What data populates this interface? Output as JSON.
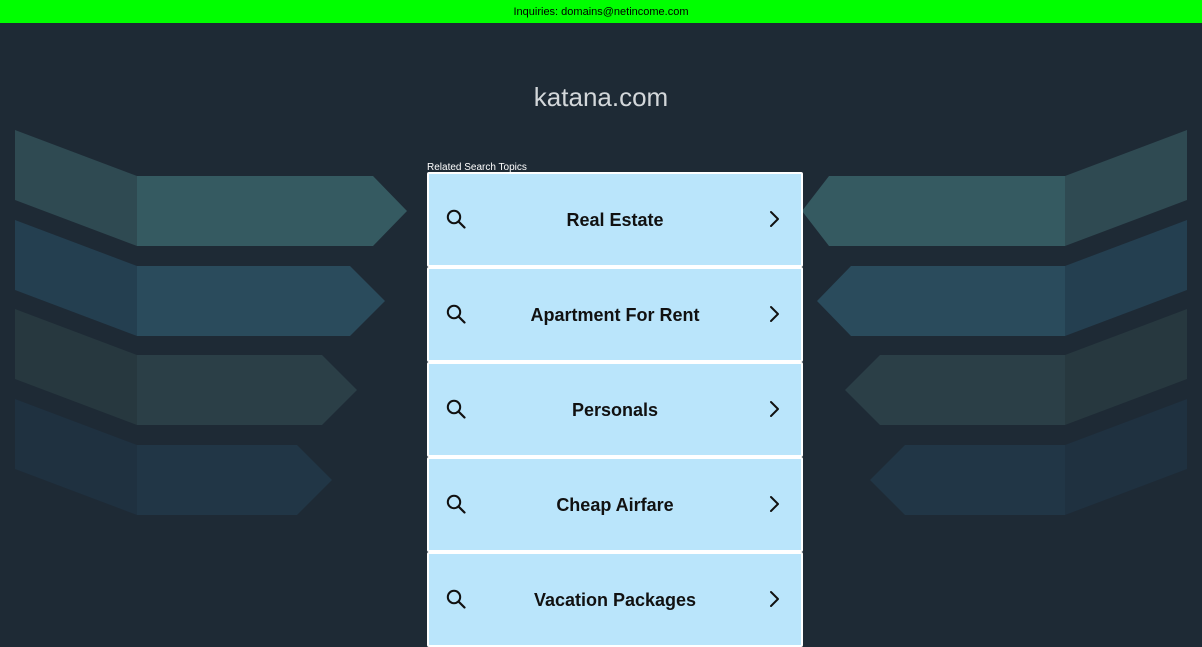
{
  "inquiries_bar": {
    "text": "Inquiries: domains@netincome.com",
    "background": "#00ff00"
  },
  "site_title": "katana.com",
  "related_label": "Related Search Topics",
  "topics": [
    {
      "label": "Real Estate",
      "icon_left": "search-icon",
      "icon_right": "chevron-right-icon"
    },
    {
      "label": "Apartment For Rent",
      "icon_left": "search-icon",
      "icon_right": "chevron-right-icon"
    },
    {
      "label": "Personals",
      "icon_left": "search-icon",
      "icon_right": "chevron-right-icon"
    },
    {
      "label": "Cheap Airfare",
      "icon_left": "search-icon",
      "icon_right": "chevron-right-icon"
    },
    {
      "label": "Vacation Packages",
      "icon_left": "search-icon",
      "icon_right": "chevron-right-icon"
    }
  ],
  "colors": {
    "page_background": "#1e2a35",
    "topic_background": "#bae5fb",
    "topic_border": "#ffffff",
    "title_text": "#d3d7da"
  }
}
